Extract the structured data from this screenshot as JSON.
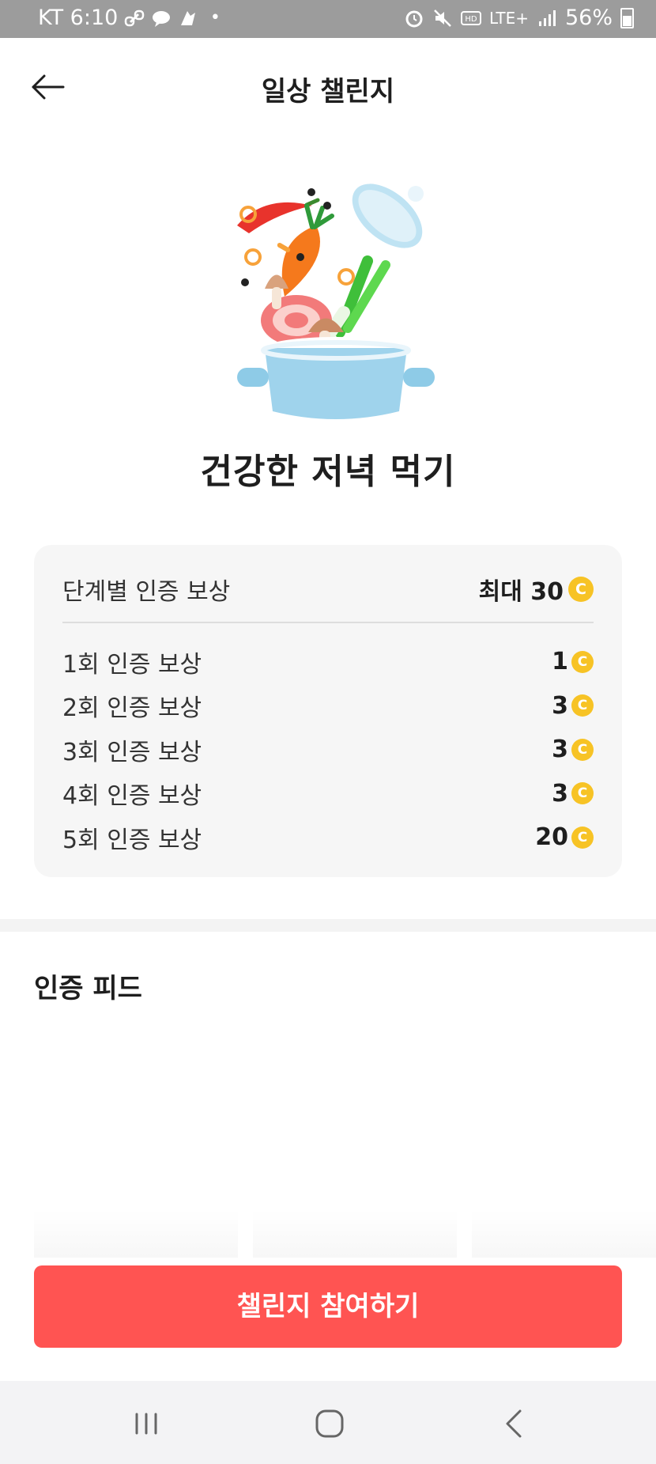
{
  "status_bar": {
    "carrier_time": "KT 6:10",
    "network": "LTE+",
    "battery": "56%",
    "battery_level": 0.56,
    "icons_left": [
      "link-icon",
      "chat-icon",
      "app-icon",
      "dot"
    ],
    "icons_right": [
      "alarm-icon",
      "mute-icon",
      "hd-icon",
      "lte-icon",
      "signal-icon"
    ]
  },
  "header": {
    "title": "일상 챌린지",
    "back_icon": "arrow-left-icon"
  },
  "challenge": {
    "title": "건강한 저녁 먹기",
    "illustration": "cooking-pot-with-vegetables"
  },
  "rewards": {
    "header_label": "단계별 인증 보상",
    "max_label": "최대 30",
    "coin_symbol": "C",
    "rows": [
      {
        "label": "1회 인증 보상",
        "value": "1"
      },
      {
        "label": "2회 인증 보상",
        "value": "3"
      },
      {
        "label": "3회 인증 보상",
        "value": "3"
      },
      {
        "label": "4회 인증 보상",
        "value": "3"
      },
      {
        "label": "5회 인증 보상",
        "value": "20"
      }
    ]
  },
  "feed": {
    "title": "인증 피드"
  },
  "cta": {
    "label": "챌린지 참여하기"
  },
  "colors": {
    "accent": "#ff5452",
    "coin": "#f7c325",
    "card_bg": "#f6f6f6"
  },
  "nav": {
    "items": [
      "recent-apps-icon",
      "home-icon",
      "back-icon"
    ]
  }
}
